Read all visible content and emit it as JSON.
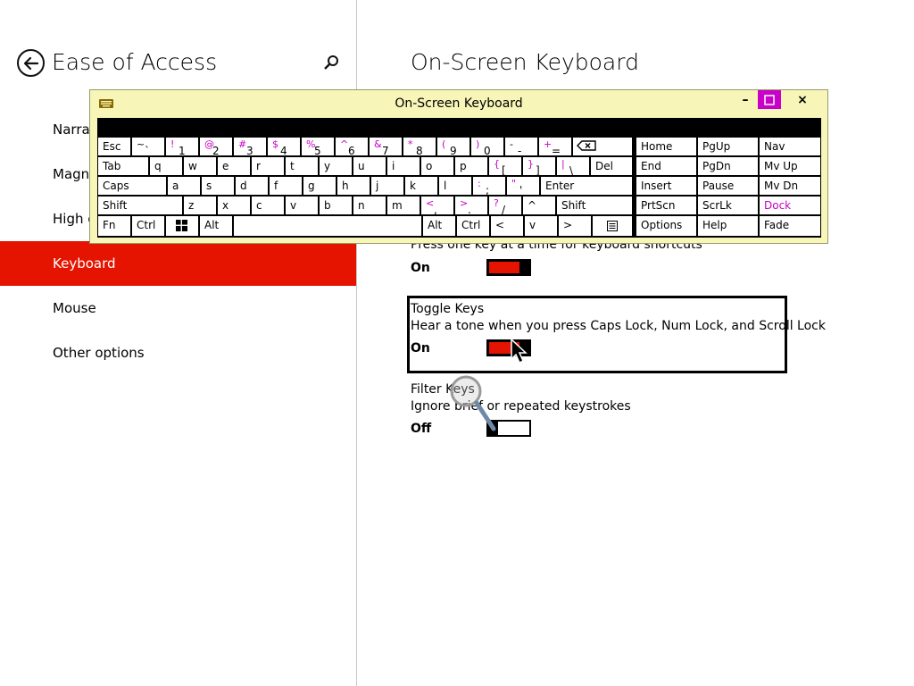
{
  "left": {
    "title": "Ease of Access",
    "nav": [
      {
        "label": "Narrator"
      },
      {
        "label": "Magnifier"
      },
      {
        "label": "High contrast"
      },
      {
        "label": "Keyboard"
      },
      {
        "label": "Mouse"
      },
      {
        "label": "Other options"
      }
    ]
  },
  "right": {
    "title": "On-Screen Keyboard",
    "sticky_desc": "Press one key at a time for keyboard shortcuts",
    "sticky_state": "On",
    "toggle_title": "Toggle Keys",
    "toggle_desc": "Hear a tone when you press Caps Lock, Num Lock, and Scroll Lock",
    "toggle_state": "On",
    "filter_title": "Filter Keys",
    "filter_desc": "Ignore brief or repeated keystrokes",
    "filter_state": "Off"
  },
  "osk": {
    "title": "On-Screen Keyboard",
    "min": "–",
    "close": "×",
    "colors": {
      "accent": "#c800c8",
      "window": "#f7f5b8"
    },
    "keys": {
      "esc": "Esc",
      "tab": "Tab",
      "caps": "Caps",
      "shift_l": "Shift",
      "fn": "Fn",
      "ctrl_l": "Ctrl",
      "alt_l": "Alt",
      "del": "Del",
      "enter": "Enter",
      "shift_r": "Shift",
      "alt_r": "Alt",
      "ctrl_r": "Ctrl",
      "home": "Home",
      "pgup": "PgUp",
      "nav": "Nav",
      "end": "End",
      "pgdn": "PgDn",
      "mvup": "Mv Up",
      "insert": "Insert",
      "pause": "Pause",
      "mvdn": "Mv Dn",
      "prtscn": "PrtScn",
      "scrlk": "ScrLk",
      "dock": "Dock",
      "options": "Options",
      "help": "Help",
      "fade": "Fade",
      "row1": [
        {
          "shift": "~",
          "base": "`"
        },
        {
          "shift": "!",
          "base": "1"
        },
        {
          "shift": "@",
          "base": "2"
        },
        {
          "shift": "#",
          "base": "3"
        },
        {
          "shift": "$",
          "base": "4"
        },
        {
          "shift": "%",
          "base": "5"
        },
        {
          "shift": "^",
          "base": "6"
        },
        {
          "shift": "&",
          "base": "7"
        },
        {
          "shift": "*",
          "base": "8"
        },
        {
          "shift": "(",
          "base": "9"
        },
        {
          "shift": ")",
          "base": "0"
        },
        {
          "shift": "-",
          "base": "-"
        },
        {
          "shift": "+",
          "base": "="
        }
      ],
      "row2": [
        "q",
        "w",
        "e",
        "r",
        "t",
        "y",
        "u",
        "i",
        "o",
        "p"
      ],
      "row2_sym": [
        {
          "shift": "{",
          "base": "["
        },
        {
          "shift": "}",
          "base": "]"
        },
        {
          "shift": "|",
          "base": "\\"
        }
      ],
      "row3": [
        "a",
        "s",
        "d",
        "f",
        "g",
        "h",
        "j",
        "k",
        "l"
      ],
      "row3_sym": [
        {
          "shift": ":",
          "base": ";"
        },
        {
          "shift": "\"",
          "base": "'"
        }
      ],
      "row4": [
        "z",
        "x",
        "c",
        "v",
        "b",
        "n",
        "m"
      ],
      "row4_sym": [
        {
          "shift": "<",
          "base": ","
        },
        {
          "shift": ">",
          "base": "."
        },
        {
          "shift": "?",
          "base": "/"
        }
      ],
      "up": "^",
      "left": "<",
      "down": "v",
      "right": ">"
    }
  }
}
